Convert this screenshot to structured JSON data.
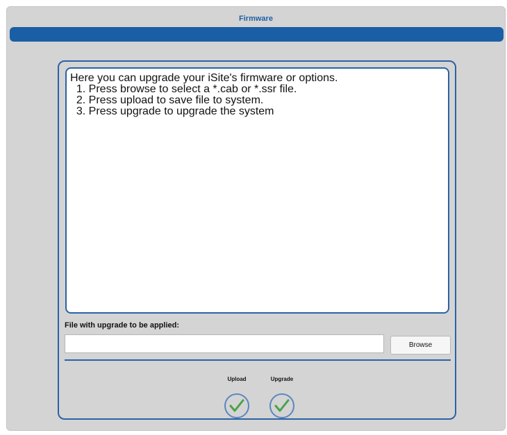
{
  "window": {
    "title": "Firmware"
  },
  "main": {
    "intro_lines": [
      "Here you can upgrade your iSite's firmware or options.",
      "  1. Press browse to select a *.cab or *.ssr file.",
      "  2. Press upload to save file to system.",
      "  3. Press upgrade to upgrade the system"
    ],
    "file_label": "File with upgrade to be applied:",
    "file_value": "",
    "browse_label": "Browse",
    "actions": {
      "upload_label": "Upload",
      "upgrade_label": "Upgrade"
    }
  },
  "colors": {
    "accent": "#1a5ea6",
    "background": "#d4d4d4",
    "check": "#4aa14a"
  }
}
